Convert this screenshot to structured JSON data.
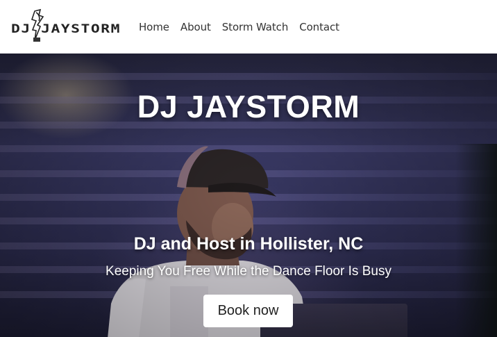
{
  "header": {
    "logo_text": "DJ JAYSTORM",
    "nav": [
      {
        "label": "Home"
      },
      {
        "label": "About"
      },
      {
        "label": "Storm Watch"
      },
      {
        "label": "Contact"
      }
    ]
  },
  "hero": {
    "title": "DJ JAYSTORM",
    "subtitle": "DJ and Host in Hollister, NC",
    "tagline": "Keeping You Free While the Dance Floor Is Busy",
    "cta_label": "Book now"
  },
  "colors": {
    "header_bg": "#ffffff",
    "nav_text": "#333333",
    "hero_bg": "#2f2f55",
    "hero_text": "#ffffff",
    "button_bg": "#ffffff",
    "button_text": "#222222"
  },
  "icons": {
    "logo": "dj-jaystorm-logo"
  }
}
